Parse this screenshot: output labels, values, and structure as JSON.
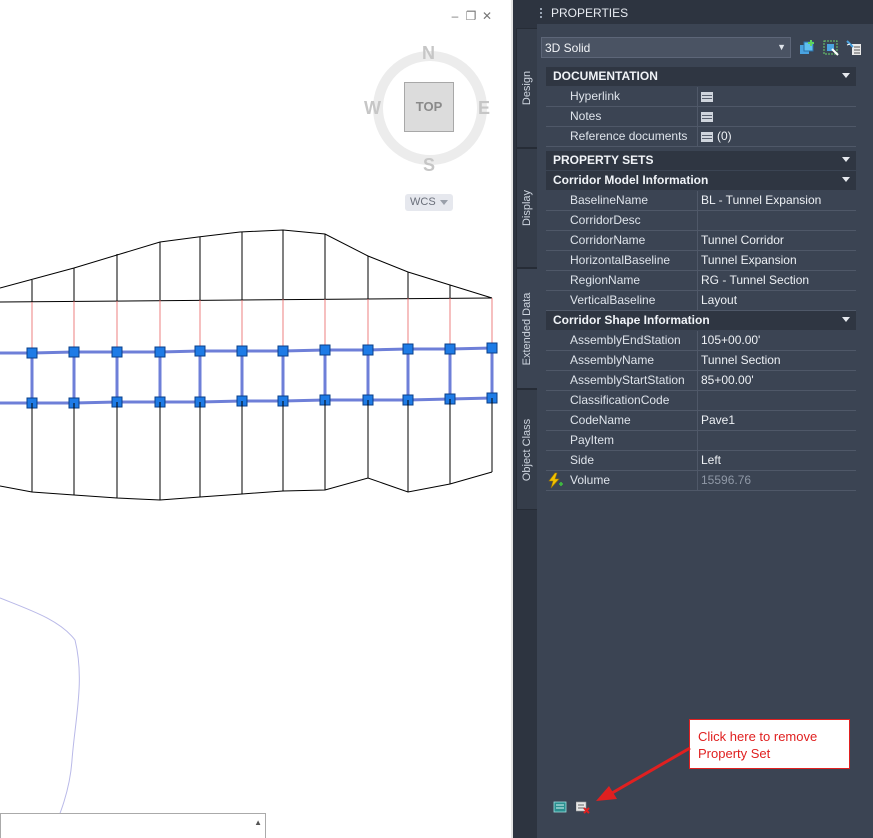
{
  "viewcube": {
    "north": "N",
    "south": "S",
    "east": "E",
    "west": "W",
    "face": "TOP",
    "ucs": "WCS"
  },
  "palette": {
    "title": "PROPERTIES",
    "object_type": "3D Solid",
    "tabs": [
      "Design",
      "Display",
      "Extended Data",
      "Object Class"
    ],
    "active_tab": "Extended Data"
  },
  "documentation": {
    "header": "DOCUMENTATION",
    "rows": [
      {
        "name": "Hyperlink",
        "value": ""
      },
      {
        "name": "Notes",
        "value": ""
      },
      {
        "name": "Reference documents",
        "value": "(0)"
      }
    ]
  },
  "property_sets": {
    "header": "PROPERTY SETS",
    "corridor_model": {
      "header": "Corridor Model Information",
      "rows": [
        {
          "name": "BaselineName",
          "value": "BL - Tunnel Expansion"
        },
        {
          "name": "CorridorDesc",
          "value": ""
        },
        {
          "name": "CorridorName",
          "value": "Tunnel Corridor"
        },
        {
          "name": "HorizontalBaseline",
          "value": "Tunnel Expansion"
        },
        {
          "name": "RegionName",
          "value": "RG - Tunnel Section"
        },
        {
          "name": "VerticalBaseline",
          "value": "Layout"
        }
      ]
    },
    "corridor_shape": {
      "header": "Corridor Shape Information",
      "rows": [
        {
          "name": "AssemblyEndStation",
          "value": "105+00.00'"
        },
        {
          "name": "AssemblyName",
          "value": "Tunnel Section"
        },
        {
          "name": "AssemblyStartStation",
          "value": "85+00.00'"
        },
        {
          "name": "ClassificationCode",
          "value": ""
        },
        {
          "name": "CodeName",
          "value": "Pave1"
        },
        {
          "name": "PayItem",
          "value": ""
        },
        {
          "name": "Side",
          "value": "Left"
        },
        {
          "name": "Volume",
          "value": "15596.76"
        }
      ]
    }
  },
  "callout": {
    "text": "Click here to remove Property Set"
  },
  "colors": {
    "palette_bg": "#3b4453",
    "category_bg": "#2f3642",
    "callout_red": "#e02020",
    "grip_blue": "#1e7be6"
  }
}
